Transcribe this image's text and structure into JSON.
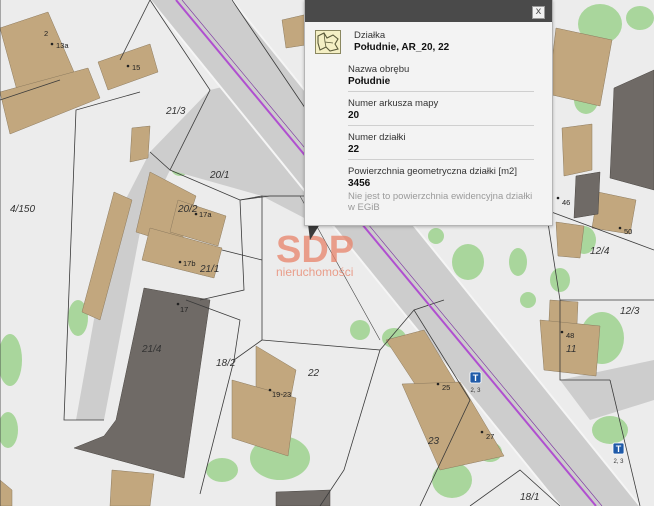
{
  "map": {
    "parcel_labels": [
      {
        "id": "p-4-150",
        "text": "4/150"
      },
      {
        "id": "p-20-1",
        "text": "20/1"
      },
      {
        "id": "p-21-3",
        "text": "21/3"
      },
      {
        "id": "p-20-2",
        "text": "20/2"
      },
      {
        "id": "p-21-1",
        "text": "21/1"
      },
      {
        "id": "p-21-4",
        "text": "21/4"
      },
      {
        "id": "p-18-2",
        "text": "18/2"
      },
      {
        "id": "p-22",
        "text": "22"
      },
      {
        "id": "p-23",
        "text": "23"
      },
      {
        "id": "p-12-4",
        "text": "12/4"
      },
      {
        "id": "p-12-3",
        "text": "12/3"
      },
      {
        "id": "p-11",
        "text": "11"
      },
      {
        "id": "p-18-1",
        "text": "18/1"
      }
    ],
    "address_labels": [
      {
        "id": "a-2",
        "text": "2"
      },
      {
        "id": "a-13a",
        "text": "13a"
      },
      {
        "id": "a-15",
        "text": "15"
      },
      {
        "id": "a-17a",
        "text": "17a"
      },
      {
        "id": "a-17b",
        "text": "17b"
      },
      {
        "id": "a-17",
        "text": "17"
      },
      {
        "id": "a-19-23",
        "text": "19-23"
      },
      {
        "id": "a-25",
        "text": "25"
      },
      {
        "id": "a-27",
        "text": "27"
      },
      {
        "id": "a-46",
        "text": "46"
      },
      {
        "id": "a-50",
        "text": "50"
      },
      {
        "id": "a-48",
        "text": "48"
      }
    ],
    "stops": [
      {
        "id": "stop-1",
        "symbol": "T",
        "label": "2, 3"
      },
      {
        "id": "stop-2",
        "symbol": "T",
        "label": "2, 3"
      }
    ],
    "watermark": {
      "big": "SDP",
      "small": "nieruchomości"
    }
  },
  "popup": {
    "type_label": "Działka",
    "name": "Południe, AR_20, 22",
    "close_symbol": "x",
    "fields": [
      {
        "label": "Nazwa obrębu",
        "value": "Południe"
      },
      {
        "label": "Numer arkusza mapy",
        "value": "20"
      },
      {
        "label": "Numer działki",
        "value": "22"
      },
      {
        "label": "Powierzchnia geometryczna działki [m2]",
        "value": "3456",
        "note": "Nie jest to powierzchnia ewidencyjna działki w EGiB"
      }
    ]
  },
  "colors": {
    "background": "#ececec",
    "road": "#cfcfcf",
    "building": "#c2a77e",
    "building_dark": "#6f6a66",
    "green": "#a6d49a",
    "tram_line": "#b04fd0",
    "parcel_line": "#3a3a3a",
    "watermark": "#e8836a"
  },
  "icons": {
    "parcel": "parcel-shape-icon",
    "close": "close-icon",
    "stop": "tram-stop-icon"
  }
}
